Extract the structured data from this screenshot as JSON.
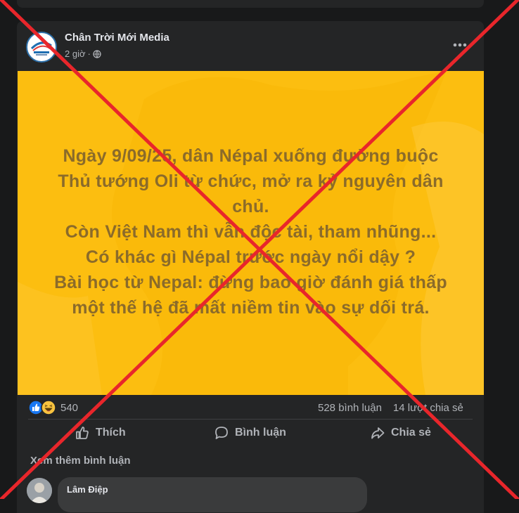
{
  "post": {
    "page_name": "Chân Trời Mới Media",
    "time": "2 giờ",
    "meta_separator": "·",
    "audience_icon": "globe-icon",
    "more_icon": "more-horizontal-icon",
    "avatar_logo_text": "Chân Trời Mới"
  },
  "banner": {
    "background_color": "#fcbe10",
    "text_color": "#8b6b2a",
    "lines": [
      "Ngày 9/09/25, dân Népal xuống đường buộc",
      "Thủ tướng Oli từ chức, mở ra kỷ nguyên dân",
      "chủ.",
      "Còn Việt Nam thì vẫn độc tài, tham nhũng...",
      "Có khác gì Népal trước ngày nổi dậy ?",
      "Bài học từ Nepal: đừng bao giờ đánh giá thấp",
      "một thế hệ đã mất niềm tin vào sự dối trá."
    ]
  },
  "engagement": {
    "reaction_icons": [
      "like-icon",
      "haha-icon"
    ],
    "reaction_count": "540",
    "comments": "528 bình luận",
    "shares": "14 lượt chia sẻ"
  },
  "actions": {
    "like": "Thích",
    "comment": "Bình luận",
    "share": "Chia sẻ"
  },
  "comments_section": {
    "see_more": "Xem thêm bình luận",
    "first_comment_author": "Lâm Điệp"
  },
  "overlay": {
    "icon": "red-cross-mark",
    "color": "#e8262b"
  }
}
